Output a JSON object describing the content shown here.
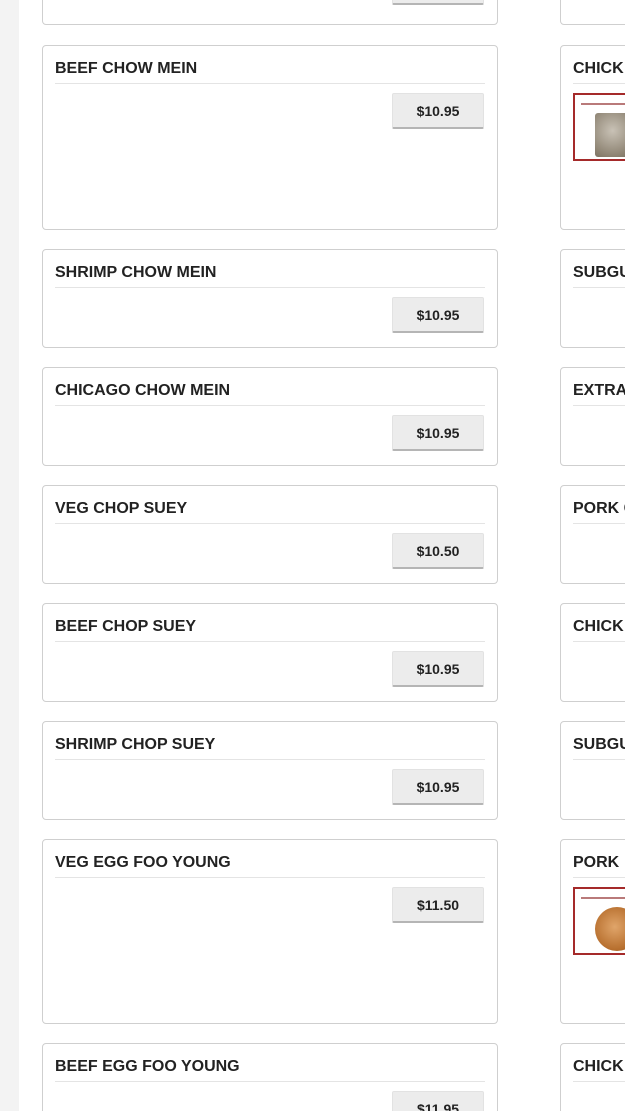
{
  "left_column": [
    {
      "title": "",
      "price": ""
    },
    {
      "title": "BEEF CHOW MEIN",
      "price": "$10.95"
    },
    {
      "title": "SHRIMP CHOW MEIN",
      "price": "$10.95"
    },
    {
      "title": "CHICAGO CHOW MEIN",
      "price": "$10.95"
    },
    {
      "title": "VEG CHOP SUEY",
      "price": "$10.50"
    },
    {
      "title": "BEEF CHOP SUEY",
      "price": "$10.95"
    },
    {
      "title": "SHRIMP CHOP SUEY",
      "price": "$10.95"
    },
    {
      "title": "VEG EGG FOO YOUNG",
      "price": "$11.50"
    },
    {
      "title": "BEEF EGG FOO YOUNG",
      "price": "$11.95"
    }
  ],
  "right_column": [
    {
      "title": ""
    },
    {
      "title": "CHICK",
      "image": "chow-mein-photo"
    },
    {
      "title": "SUBGU"
    },
    {
      "title": "EXTRA"
    },
    {
      "title": "PORK C"
    },
    {
      "title": "CHICK"
    },
    {
      "title": "SUBGU"
    },
    {
      "title": "PORK",
      "image": "egg-foo-young-photo"
    },
    {
      "title": "CHICK"
    }
  ]
}
